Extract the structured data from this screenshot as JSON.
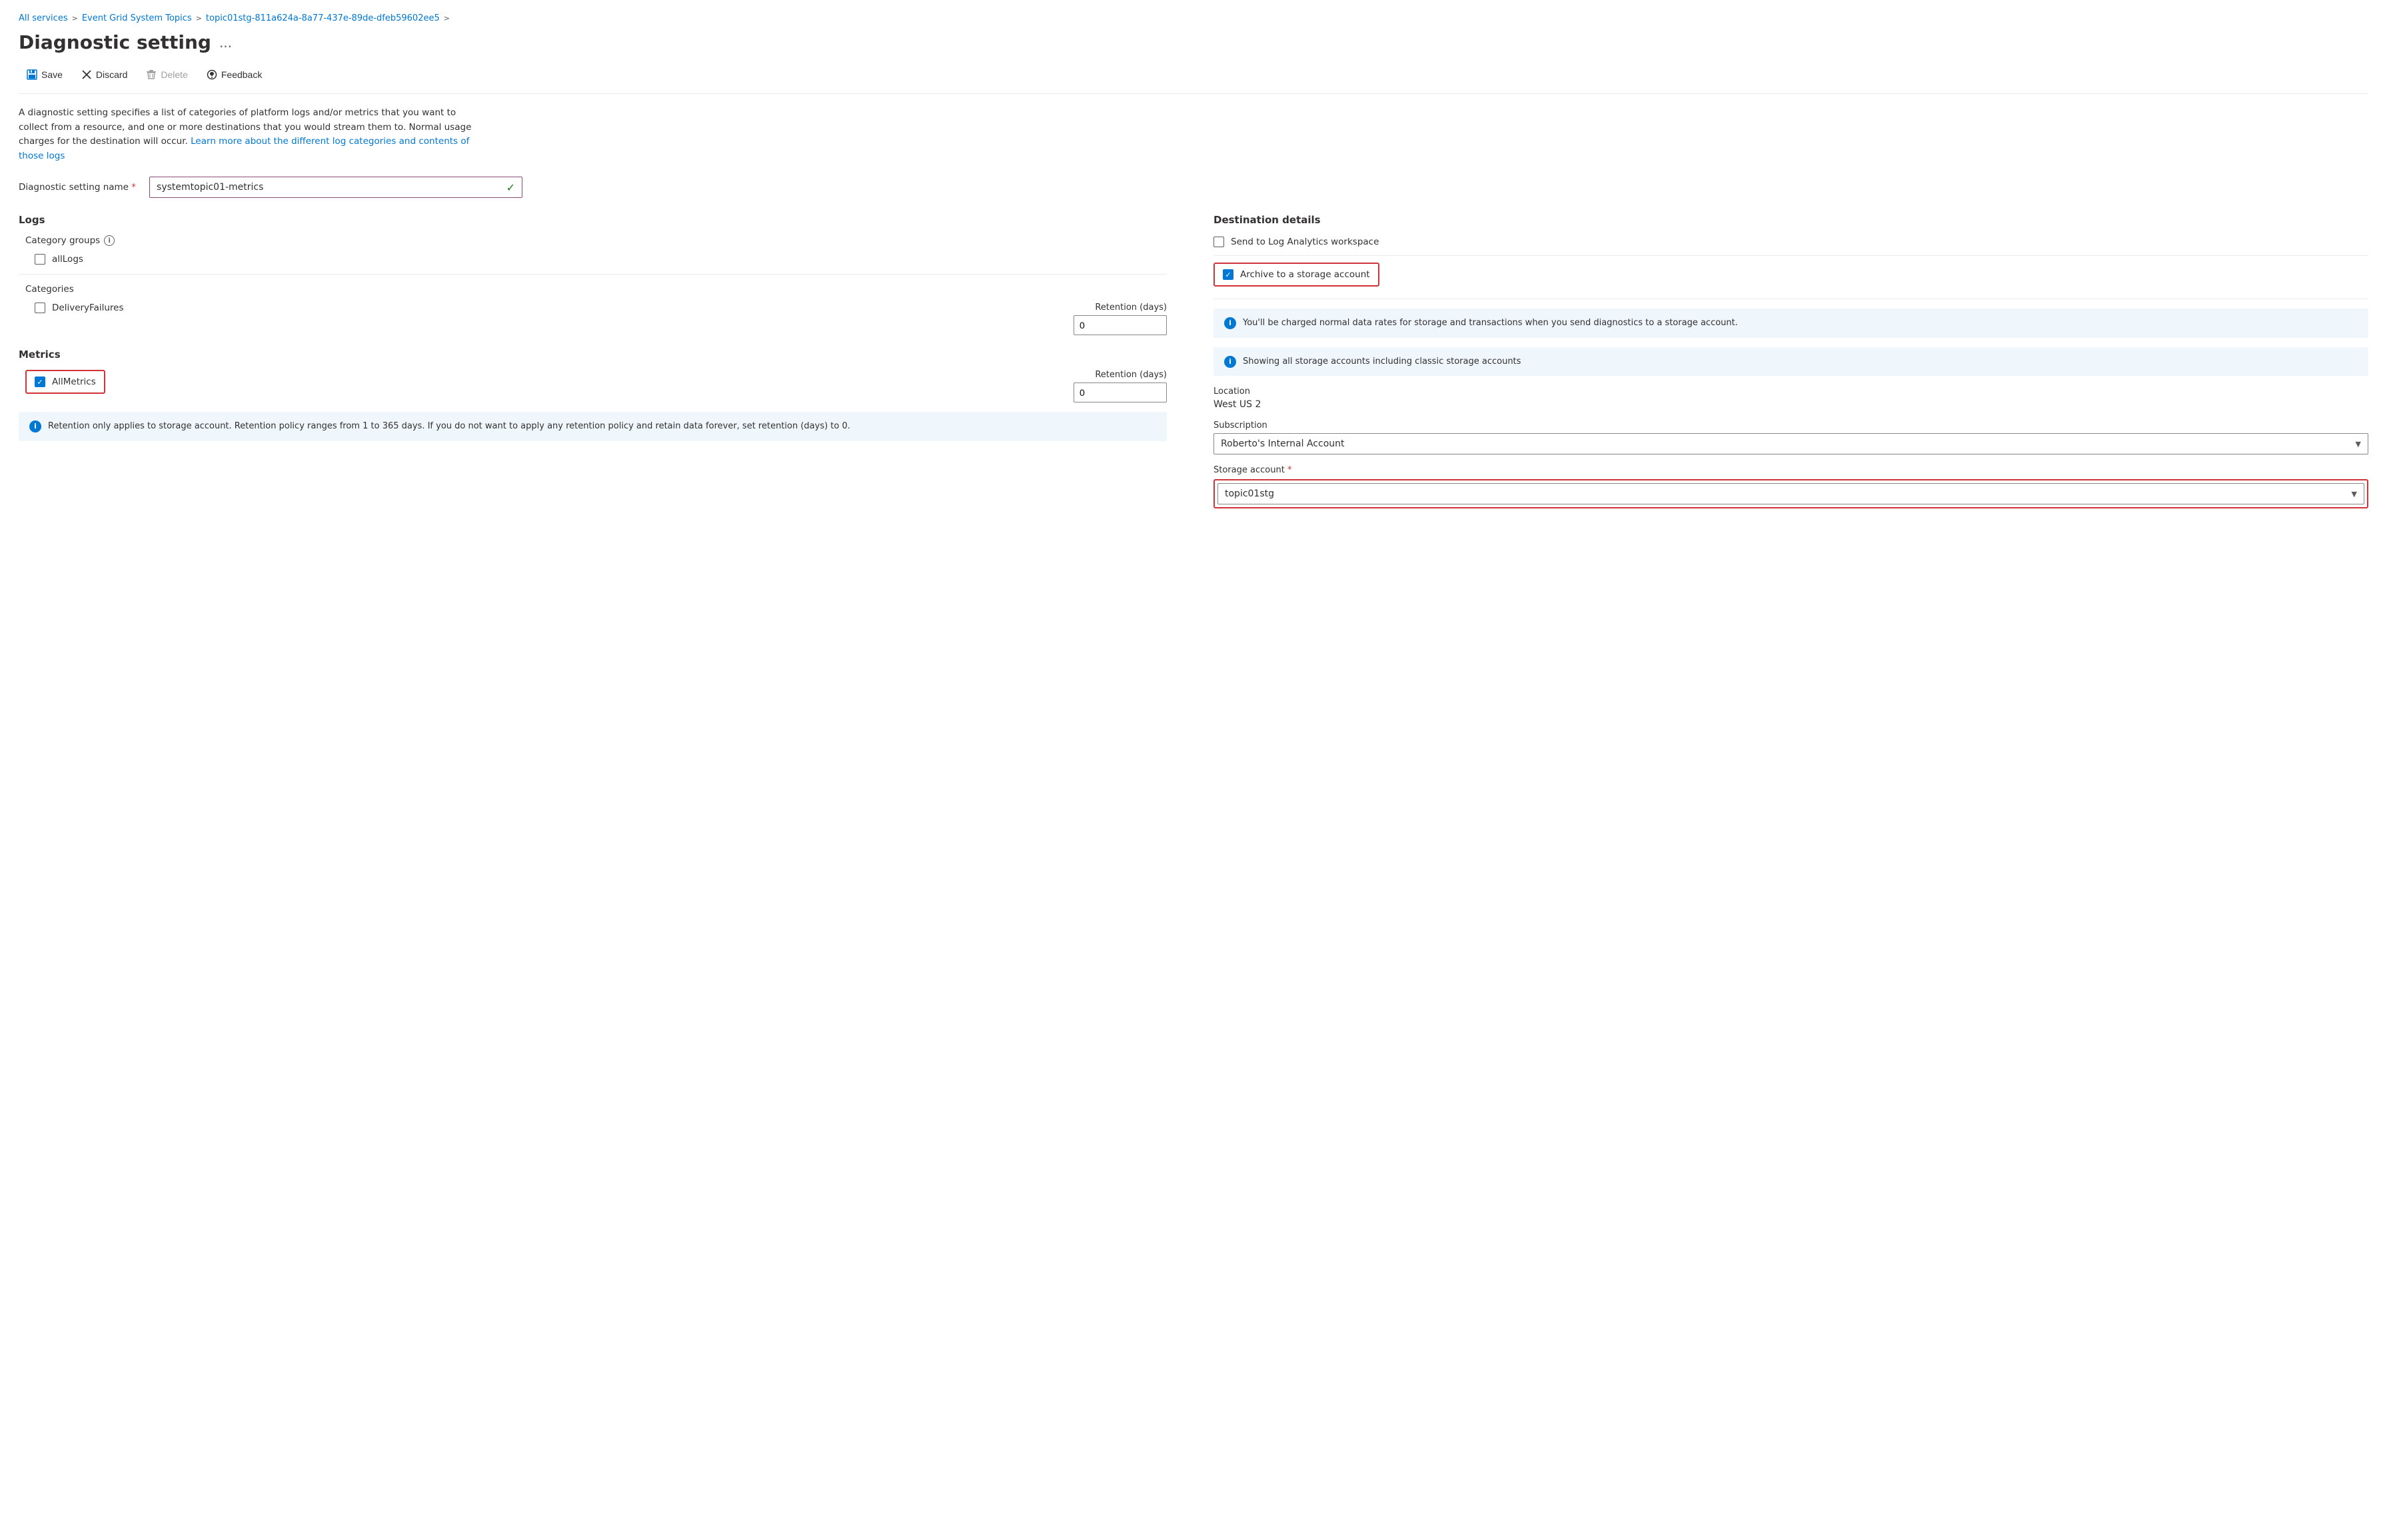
{
  "breadcrumb": {
    "items": [
      {
        "label": "All services",
        "href": "#"
      },
      {
        "label": "Event Grid System Topics",
        "href": "#"
      },
      {
        "label": "topic01stg-811a624a-8a77-437e-89de-dfeb59602ee5",
        "href": "#"
      }
    ],
    "separators": [
      ">",
      ">"
    ]
  },
  "header": {
    "title": "Diagnostic setting",
    "ellipsis": "..."
  },
  "toolbar": {
    "save_label": "Save",
    "discard_label": "Discard",
    "delete_label": "Delete",
    "feedback_label": "Feedback"
  },
  "description": {
    "text": "A diagnostic setting specifies a list of categories of platform logs and/or metrics that you want to collect from a resource, and one or more destinations that you would stream them to. Normal usage charges for the destination will occur. ",
    "link_text": "Learn more about the different log categories and contents of those logs"
  },
  "diagnostic_name": {
    "label": "Diagnostic setting name",
    "value": "systemtopic01-metrics",
    "placeholder": "systemtopic01-metrics"
  },
  "logs": {
    "title": "Logs",
    "category_groups": {
      "label": "Category groups",
      "items": [
        {
          "id": "allLogs",
          "label": "allLogs",
          "checked": false
        }
      ]
    },
    "categories": {
      "label": "Categories",
      "items": [
        {
          "id": "deliveryFailures",
          "label": "DeliveryFailures",
          "checked": false,
          "retention_label": "Retention (days)",
          "retention_value": "0"
        }
      ]
    }
  },
  "metrics": {
    "title": "Metrics",
    "items": [
      {
        "id": "allMetrics",
        "label": "AllMetrics",
        "checked": true,
        "retention_label": "Retention (days)",
        "retention_value": "0"
      }
    ],
    "info_text": "Retention only applies to storage account. Retention policy ranges from 1 to 365 days. If you do not want to apply any retention policy and retain data forever, set retention (days) to 0."
  },
  "destination": {
    "title": "Destination details",
    "options": [
      {
        "id": "log_analytics",
        "label": "Send to Log Analytics workspace",
        "checked": false
      },
      {
        "id": "archive_storage",
        "label": "Archive to a storage account",
        "checked": true
      }
    ],
    "archive_info_1": "You'll be charged normal data rates for storage and transactions when you send diagnostics to a storage account.",
    "archive_info_2": "Showing all storage accounts including classic storage accounts",
    "location": {
      "label": "Location",
      "value": "West US 2"
    },
    "subscription": {
      "label": "Subscription",
      "value": "Roberto's Internal Account"
    },
    "storage_account": {
      "label": "Storage account",
      "required": true,
      "value": "topic01stg",
      "placeholder": "topic01stg"
    }
  }
}
